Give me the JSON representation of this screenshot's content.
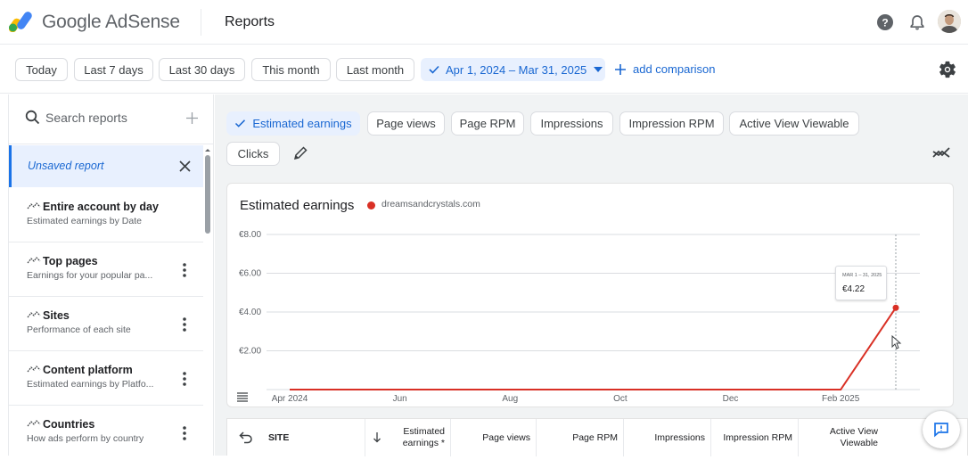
{
  "app": {
    "brand": "Google AdSense",
    "page_title": "Reports"
  },
  "date_filters": {
    "presets": [
      "Today",
      "Last 7 days",
      "Last 30 days",
      "This month",
      "Last month"
    ],
    "range": "Apr 1, 2024 – Mar 31, 2025",
    "add_comparison": "add comparison"
  },
  "sidebar": {
    "search_placeholder": "Search reports",
    "unsaved": "Unsaved report",
    "items": [
      {
        "name": "Entire account by day",
        "sub": "Estimated earnings by Date"
      },
      {
        "name": "Top pages",
        "sub": "Earnings for your popular pa..."
      },
      {
        "name": "Sites",
        "sub": "Performance of each site"
      },
      {
        "name": "Content platform",
        "sub": "Estimated earnings by Platfo..."
      },
      {
        "name": "Countries",
        "sub": "How ads perform by country"
      }
    ]
  },
  "metrics": [
    "Estimated earnings",
    "Page views",
    "Page RPM",
    "Impressions",
    "Impression RPM",
    "Active View Viewable",
    "Clicks"
  ],
  "chart": {
    "title": "Estimated earnings",
    "legend": "dreamsandcrystals.com",
    "tooltip_label": "MAR 1 – 31, 2025",
    "tooltip_value": "€4.22"
  },
  "chart_data": {
    "type": "line",
    "title": "Estimated earnings",
    "series": [
      {
        "name": "dreamsandcrystals.com",
        "color": "#d93025",
        "x": [
          "Apr 2024",
          "May 2024",
          "Jun 2024",
          "Jul 2024",
          "Aug 2024",
          "Sep 2024",
          "Oct 2024",
          "Nov 2024",
          "Dec 2024",
          "Jan 2025",
          "Feb 2025",
          "Mar 2025"
        ],
        "values": [
          0,
          0,
          0,
          0,
          0,
          0,
          0,
          0,
          0,
          0,
          0,
          4.22
        ]
      }
    ],
    "x_tick_labels": [
      "Apr 2024",
      "Jun",
      "Aug",
      "Oct",
      "Dec",
      "Feb 2025"
    ],
    "y_tick_labels": [
      "€2.00",
      "€4.00",
      "€6.00",
      "€8.00"
    ],
    "ylim": [
      0,
      8
    ],
    "grid": true
  },
  "table": {
    "headers": [
      "SITE",
      "Estimated earnings *",
      "Page views",
      "Page RPM",
      "Impressions",
      "Impression RPM",
      "Active View Viewable"
    ]
  }
}
